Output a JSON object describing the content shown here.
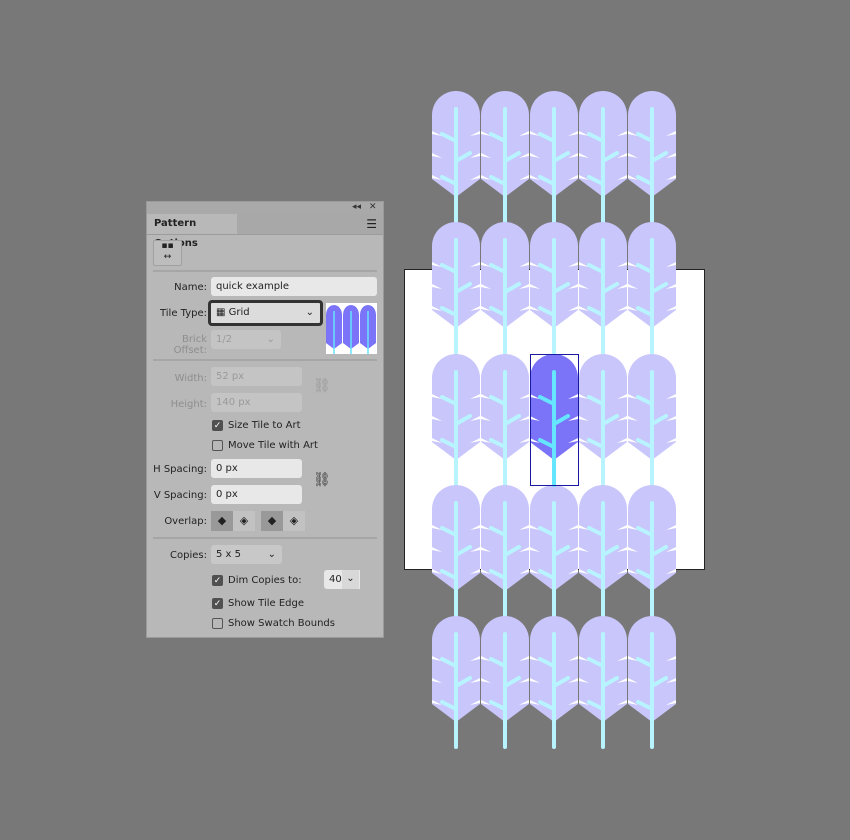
{
  "panel": {
    "title": "Pattern Options",
    "collapse_icon": "double-chevron-left",
    "close_icon": "close",
    "menu_icon": "hamburger",
    "name_label": "Name:",
    "name_value": "quick example",
    "tile_type_label": "Tile Type:",
    "tile_type_value": "Grid",
    "brick_offset_label": "Brick Offset:",
    "brick_offset_value": "1/2",
    "width_label": "Width:",
    "width_value": "52 px",
    "height_label": "Height:",
    "height_value": "140 px",
    "size_tile_label": "Size Tile to Art",
    "size_tile_checked": true,
    "move_tile_label": "Move Tile with Art",
    "move_tile_checked": false,
    "h_spacing_label": "H Spacing:",
    "h_spacing_value": "0 px",
    "v_spacing_label": "V Spacing:",
    "v_spacing_value": "0 px",
    "overlap_label": "Overlap:",
    "copies_label": "Copies:",
    "copies_value": "5 x 5",
    "dim_label": "Dim Copies to:",
    "dim_checked": true,
    "dim_value": "40%",
    "show_edge_label": "Show Tile Edge",
    "show_edge_checked": true,
    "show_bounds_label": "Show Swatch Bounds",
    "show_bounds_checked": false
  },
  "colors": {
    "leaf": "#7b73f8",
    "stem": "#66e5ff",
    "leaf_dim": "#c9c6fb",
    "stem_dim": "#b8f4ff",
    "tile_edge": "#1a1aa0"
  }
}
